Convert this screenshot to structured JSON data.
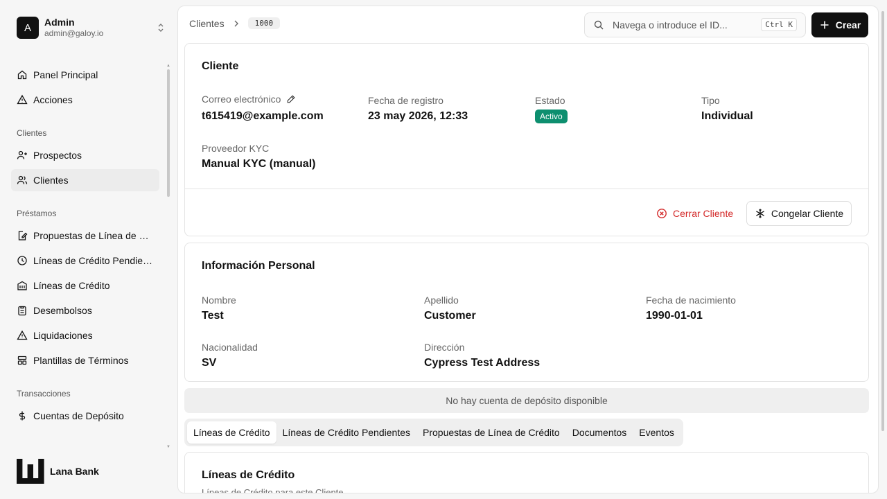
{
  "user": {
    "initial": "A",
    "name": "Admin",
    "email": "admin@galoy.io"
  },
  "sidebar": {
    "top_items": [
      {
        "label": "Panel Principal",
        "icon": "home-icon"
      },
      {
        "label": "Acciones",
        "icon": "alert-triangle-icon"
      }
    ],
    "groups": [
      {
        "title": "Clientes",
        "items": [
          {
            "label": "Prospectos",
            "icon": "user-plus-icon"
          },
          {
            "label": "Clientes",
            "icon": "users-icon",
            "active": true
          }
        ]
      },
      {
        "title": "Préstamos",
        "items": [
          {
            "label": "Propuestas de Línea de Cr...",
            "icon": "file-edit-icon"
          },
          {
            "label": "Líneas de Crédito Pendient...",
            "icon": "clock-icon"
          },
          {
            "label": "Líneas de Crédito",
            "icon": "building-icon"
          },
          {
            "label": "Desembolsos",
            "icon": "clipboard-icon"
          },
          {
            "label": "Liquidaciones",
            "icon": "alert-triangle-icon"
          },
          {
            "label": "Plantillas de Términos",
            "icon": "layout-icon"
          }
        ]
      },
      {
        "title": "Transacciones",
        "items": [
          {
            "label": "Cuentas de Depósito",
            "icon": "dollar-icon"
          }
        ]
      }
    ],
    "brand": "Lana Bank"
  },
  "header": {
    "breadcrumb": {
      "section": "Clientes",
      "id": "1000"
    },
    "search": {
      "placeholder": "Navega o introduce el ID...",
      "shortcut": "Ctrl K"
    },
    "create_label": "Crear"
  },
  "customer_card": {
    "title": "Cliente",
    "email_label": "Correo electrónico",
    "email": "t615419@example.com",
    "registered_label": "Fecha de registro",
    "registered": "23 may 2026, 12:33",
    "status_label": "Estado",
    "status": "Activo",
    "type_label": "Tipo",
    "type": "Individual",
    "kyc_label": "Proveedor KYC",
    "kyc": "Manual KYC (manual)",
    "close_label": "Cerrar Cliente",
    "freeze_label": "Congelar Cliente"
  },
  "personal_card": {
    "title": "Información Personal",
    "first_name_label": "Nombre",
    "first_name": "Test",
    "last_name_label": "Apellido",
    "last_name": "Customer",
    "dob_label": "Fecha de nacimiento",
    "dob": "1990-01-01",
    "nationality_label": "Nacionalidad",
    "nationality": "SV",
    "address_label": "Dirección",
    "address": "Cypress Test Address"
  },
  "deposit_notice": "No hay cuenta de depósito disponible",
  "tabs": [
    "Líneas de Crédito",
    "Líneas de Crédito Pendientes",
    "Propuestas de Línea de Crédito",
    "Documentos",
    "Eventos"
  ],
  "credit_card": {
    "title": "Líneas de Crédito",
    "subtitle": "Líneas de Crédito para este Cliente"
  },
  "colors": {
    "accent": "#111111",
    "status_active": "#0d8f6f",
    "danger": "#d32828"
  }
}
